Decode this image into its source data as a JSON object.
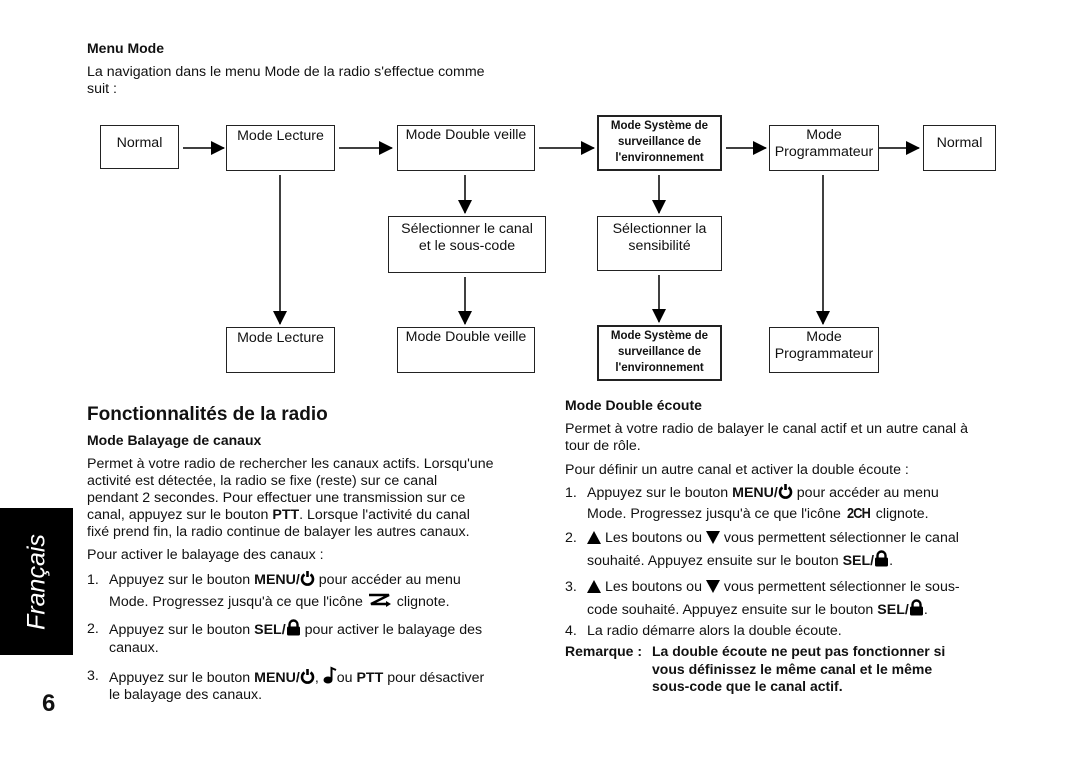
{
  "menu_mode": {
    "heading": "Menu Mode",
    "intro_line1": "La navigation dans le menu Mode de la radio s'effectue comme",
    "intro_line2": "suit :"
  },
  "diagram": {
    "top_row": [
      "Normal",
      "Mode Lecture",
      "Mode Double veille",
      "Mode Système de surveillance de l'environnement",
      "Mode Programmateur",
      "Normal"
    ],
    "surveillance_lines": [
      "Mode Système de",
      "surveillance de",
      "l'environnement"
    ],
    "programmateur_lines": [
      "Mode",
      "Programmateur"
    ],
    "middle_row": {
      "select_channel_lines": [
        "Sélectionner le canal",
        "et le sous-code"
      ],
      "select_sensitivity_lines": [
        "Sélectionner la",
        "sensibilité"
      ]
    },
    "bottom_row": {
      "lecture": "Mode Lecture",
      "double_veille": "Mode Double veille",
      "surveillance_lines": [
        "Mode Système de",
        "surveillance de",
        "l'environnement"
      ],
      "programmateur_lines": [
        "Mode",
        "Programmateur"
      ]
    }
  },
  "features": {
    "title": "Fonctionnalités de la radio",
    "scan": {
      "heading": "Mode Balayage de canaux",
      "para_lines": [
        "Permet à votre radio de rechercher les canaux actifs. Lorsqu'une",
        "activité est détectée, la radio se fixe (reste) sur ce canal",
        "pendant 2 secondes. Pour effectuer une transmission sur ce",
        "canal, appuyez sur le bouton ",
        "PTT",
        ". Lorsque l'activité du canal",
        "fixé prend fin, la radio continue de balayer les autres canaux."
      ],
      "activate_intro": "Pour activer le balayage des canaux :",
      "steps": [
        {
          "num": "1.",
          "a": "Appuyez sur le bouton ",
          "key": "MENU/",
          "b": " pour accéder au menu",
          "line2a": "Mode. Progressez jusqu'à ce que l'icône ",
          "line2b": " clignote."
        },
        {
          "num": "2.",
          "a": "Appuyez sur le bouton ",
          "key": "SEL/",
          "b": " pour activer le balayage des",
          "line2": "canaux."
        },
        {
          "num": "3.",
          "a": "Appuyez sur le bouton ",
          "key": "MENU/",
          "c": ", ",
          "d": "ou ",
          "key2": "PTT",
          "e": " pour désactiver",
          "line2": "le balayage des canaux."
        }
      ]
    },
    "dual": {
      "heading": "Mode Double écoute",
      "para_line1": "Permet à votre radio de balayer le canal actif et un autre canal à",
      "para_line2": "tour de rôle.",
      "intro": "Pour définir un autre canal et activer la double écoute :",
      "steps": [
        {
          "num": "1.",
          "a": "Appuyez sur le bouton ",
          "key": "MENU/",
          "b": " pour accéder au menu",
          "line2a": "Mode. Progressez jusqu'à ce que l'icône ",
          "icon_text": "2CH",
          "line2b": " clignote."
        },
        {
          "num": "2.",
          "a": " Les boutons ou ",
          "b": " vous permettent sélectionner le canal",
          "line2a": "souhaité. Appuyez ensuite sur le bouton ",
          "key": "SEL/",
          "end": "."
        },
        {
          "num": "3.",
          "a": " Les boutons ou ",
          "b": " vous permettent sélectionner le sous-",
          "line2a": "code souhaité. Appuyez ensuite sur le bouton ",
          "key": "SEL/",
          "end": "."
        },
        {
          "num": "4.",
          "a": "La radio démarre alors la double écoute."
        }
      ],
      "note_label": "Remarque :",
      "note_lines": [
        "La double écoute ne peut pas fonctionner si",
        "vous définissez le même canal et le même",
        "sous-code que le canal actif."
      ]
    }
  },
  "side_tab": "Français",
  "page_number": "6",
  "icons": {
    "power": "power-icon",
    "lock": "lock-icon",
    "scan": "scan-icon",
    "note": "music-note-icon",
    "up": "up-triangle-icon",
    "down": "down-triangle-icon"
  }
}
